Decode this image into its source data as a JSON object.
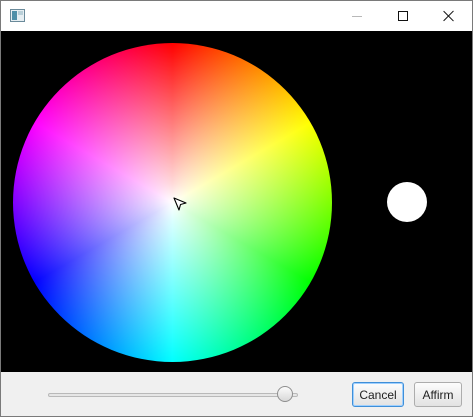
{
  "window": {
    "title": "",
    "controls": {
      "minimize": "minimize-icon",
      "maximize": "maximize-icon",
      "close": "close-icon"
    }
  },
  "color_picker": {
    "selected_color": "#ffffff",
    "wheel_hues": [
      "#ff0000",
      "#ffff00",
      "#00ff00",
      "#00ffff",
      "#0000ff",
      "#ff00ff"
    ]
  },
  "brightness_slider": {
    "value_fraction": 1.0
  },
  "buttons": {
    "cancel_label": "Cancel",
    "affirm_label": "Affirm"
  }
}
